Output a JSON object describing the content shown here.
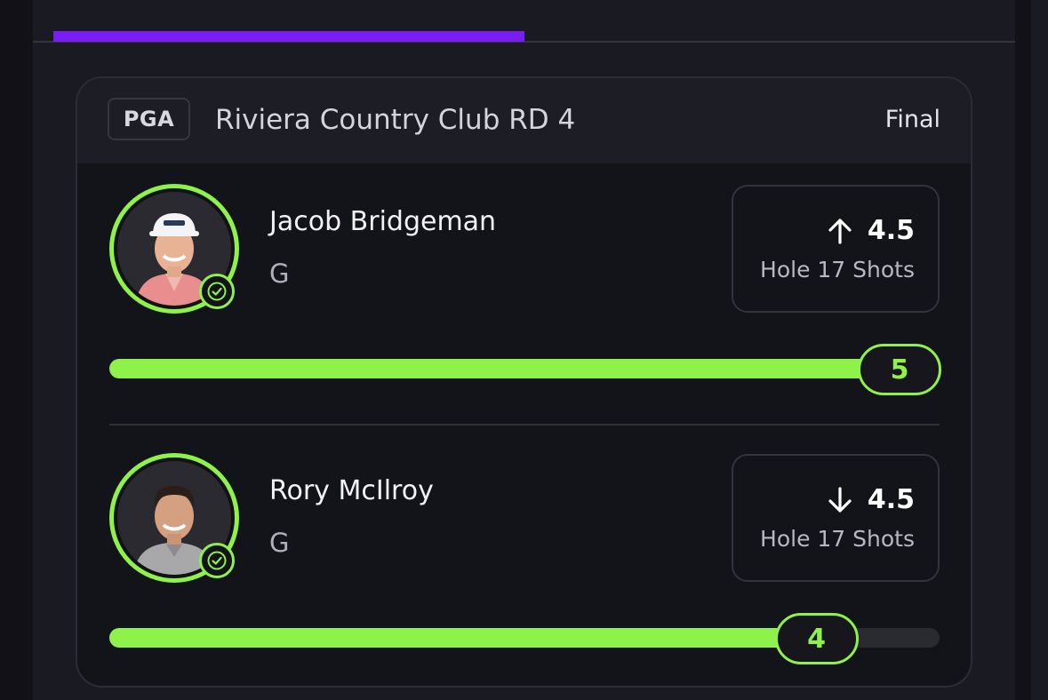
{
  "event": {
    "league": "PGA",
    "title": "Riviera Country Club RD 4",
    "status": "Final"
  },
  "players": [
    {
      "name": "Jacob Bridgeman",
      "position": "G",
      "line_direction": "up",
      "line_value": "4.5",
      "stat_label": "Hole 17 Shots",
      "result": "5",
      "progress_pct": 100,
      "icons": [
        "arrow-up-icon",
        "check-icon"
      ]
    },
    {
      "name": "Rory McIlroy",
      "position": "G",
      "line_direction": "down",
      "line_value": "4.5",
      "stat_label": "Hole 17 Shots",
      "result": "4",
      "progress_pct": 90,
      "icons": [
        "arrow-down-icon",
        "check-icon"
      ]
    }
  ],
  "colors": {
    "accent_green": "#8ef24a",
    "tab_indicator": "#7a1cf5",
    "background": "#111117",
    "card": "#13131a"
  }
}
